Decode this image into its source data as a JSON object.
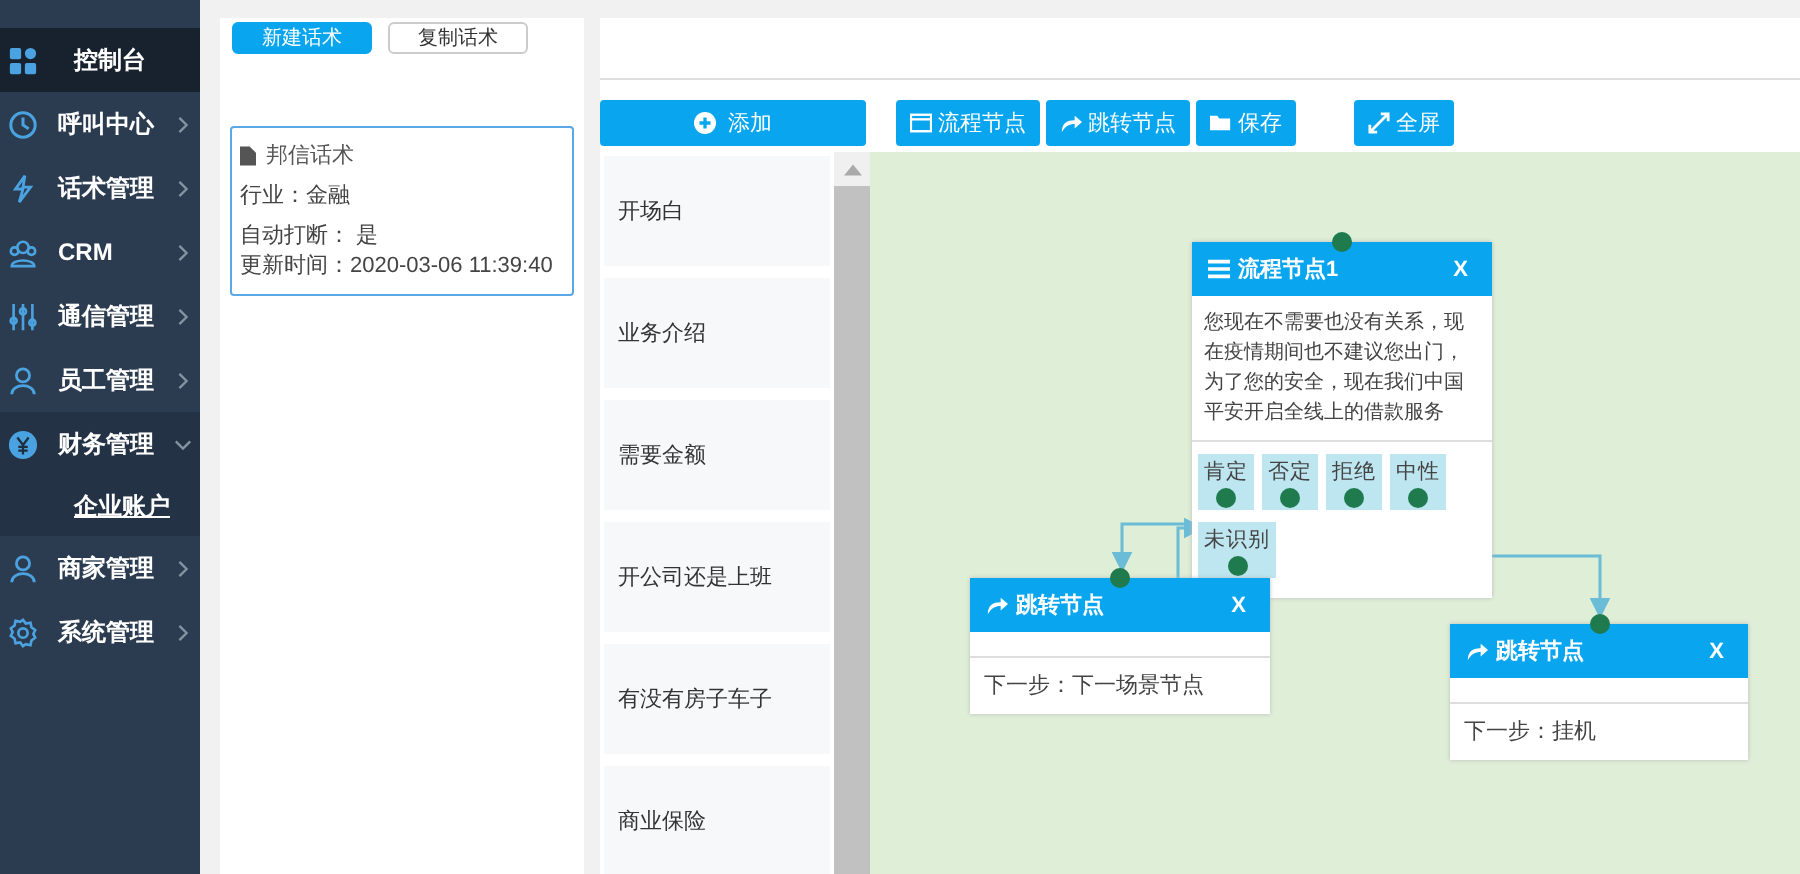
{
  "sidebar": {
    "items": [
      {
        "label": "控制台",
        "kind": "link",
        "selected": true
      },
      {
        "label": "呼叫中心",
        "kind": "menu",
        "selected": false,
        "expanded": false
      },
      {
        "label": "话术管理",
        "kind": "menu",
        "selected": false,
        "expanded": false
      },
      {
        "label": "CRM",
        "kind": "menu",
        "selected": false,
        "expanded": false
      },
      {
        "label": "通信管理",
        "kind": "menu",
        "selected": false,
        "expanded": false
      },
      {
        "label": "员工管理",
        "kind": "menu",
        "selected": false,
        "expanded": false
      },
      {
        "label": "财务管理",
        "kind": "menu",
        "selected": false,
        "expanded": true,
        "children": [
          {
            "label": "企业账户",
            "kind": "link",
            "selected": true
          }
        ]
      },
      {
        "label": "商家管理",
        "kind": "menu",
        "selected": false,
        "expanded": false
      },
      {
        "label": "系统管理",
        "kind": "menu",
        "selected": false,
        "expanded": false
      }
    ]
  },
  "tabs": [
    {
      "label": "新建话术",
      "selected": true
    },
    {
      "label": "复制话术",
      "selected": false
    }
  ],
  "script_card": {
    "title": "邦信话术",
    "lines": [
      "行业：金融",
      "自动打断： 是",
      "更新时间：2020-03-06 11:39:40"
    ]
  },
  "add_button": "添加",
  "toolbar": [
    {
      "label": "流程节点",
      "kind": "flow"
    },
    {
      "label": "跳转节点",
      "kind": "jump"
    },
    {
      "label": "保存",
      "kind": "save"
    },
    {
      "label": "全屏",
      "kind": "fullscreen"
    }
  ],
  "scenes": [
    "开场白",
    "业务介绍",
    "需要金额",
    "开公司还是上班",
    "有没有房子车子",
    "商业保险"
  ],
  "nodes": [
    {
      "kind": "flow",
      "title": "流程节点1",
      "close": "X",
      "text": "您现在不需要也没有关系，现在疫情期间也不建议您出门，为了您的安全，现在我们中国平安开启全线上的借款服务",
      "options": [
        "肯定",
        "否定",
        "拒绝",
        "中性",
        "未识别"
      ]
    },
    {
      "kind": "jump",
      "title": "跳转节点",
      "close": "X",
      "next": "下一步：下一场景节点"
    },
    {
      "kind": "jump",
      "title": "跳转节点",
      "close": "X",
      "next": "下一步：挂机"
    }
  ]
}
